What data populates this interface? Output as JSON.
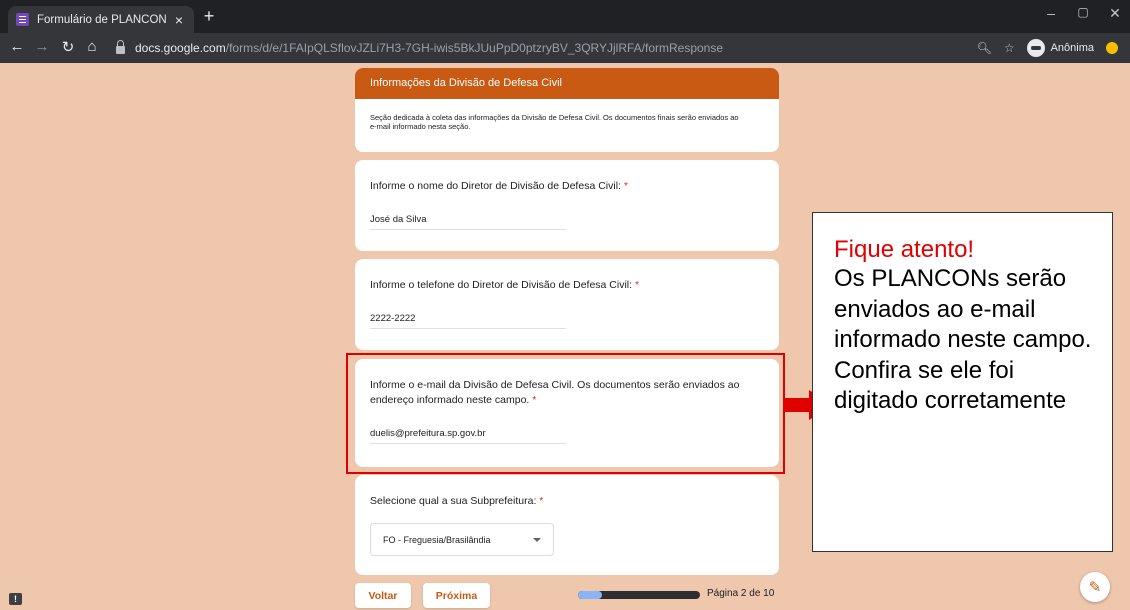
{
  "browser": {
    "tab_title": "Formulário de PLANCON",
    "tab_close": "×",
    "new_tab": "+",
    "url_host": "docs.google.com",
    "url_path": "/forms/d/e/1FAIpQLSflovJZLi7H3-7GH-iwis5BkJUuPpD0ptzryBV_3QRYJjlRFA/formResponse",
    "profile_label": "Anônima",
    "icons": [
      "back-icon",
      "forward-icon",
      "reload-icon",
      "home-icon",
      "lock-icon",
      "zoom-icon",
      "star-icon",
      "incognito-icon"
    ]
  },
  "form": {
    "section": {
      "title": "Informações da Divisão de Defesa Civil",
      "description": "Seção dedicada à coleta das informações da Divisão de Defesa Civil. Os documentos finais serão enviados ao e-mail informado nesta seção."
    },
    "questions": [
      {
        "title": "Informe o nome do Diretor de Divisão de Defesa Civil:",
        "required_mark": "*",
        "value": "José da Silva"
      },
      {
        "title": "Informe o telefone do Diretor de Divisão de Defesa Civil:",
        "required_mark": "*",
        "value": "2222-2222"
      },
      {
        "title": "Informe o e-mail da Divisão de Defesa Civil. Os documentos serão enviados ao endereço informado neste campo.",
        "required_mark": "*",
        "value": "duelis@prefeitura.sp.gov.br"
      },
      {
        "title": "Selecione qual a sua Subprefeitura:",
        "required_mark": "*",
        "value": "FO - Freguesia/Brasilândia"
      }
    ],
    "back_label": "Voltar",
    "next_label": "Próxima",
    "page_label": "Página 2 de 10",
    "progress": 0.2,
    "accent_color": "#c85a13"
  },
  "callout": {
    "title": "Fique atento!",
    "body": "Os PLANCONs serão enviados ao e-mail informado neste campo. Confira se ele foi digitado corretamente",
    "highlight_color": "#e00000"
  }
}
